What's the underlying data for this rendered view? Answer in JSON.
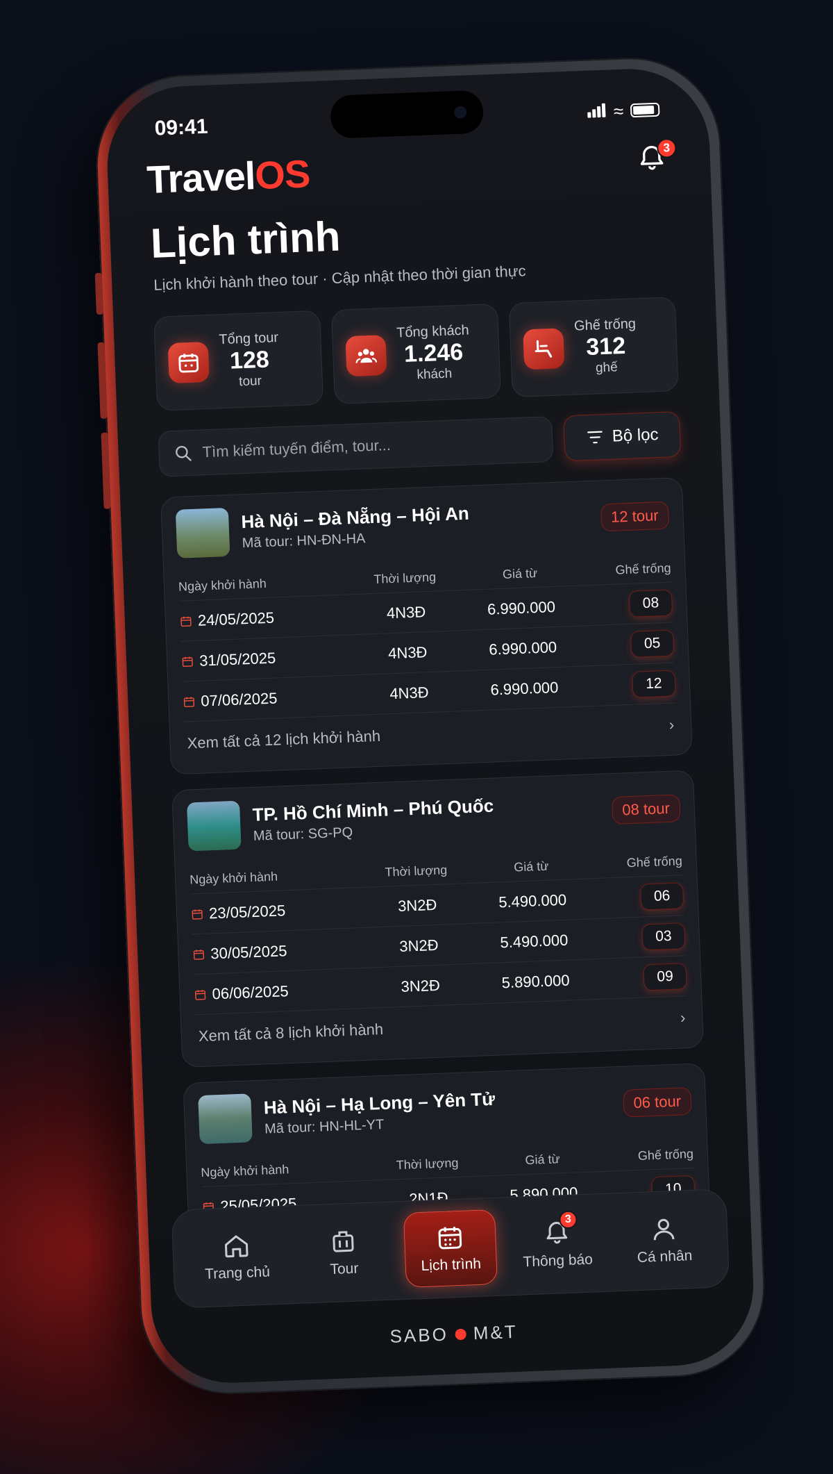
{
  "status": {
    "time": "09:41"
  },
  "app": {
    "logo_a": "Travel",
    "logo_b": "OS",
    "notif_count": "3"
  },
  "page": {
    "title": "Lịch trình",
    "subtitle": "Lịch khởi hành theo tour · Cập nhật theo thời gian thực"
  },
  "stats": [
    {
      "label": "Tổng tour",
      "value": "128",
      "unit": "tour",
      "icon": "calendar-icon"
    },
    {
      "label": "Tổng khách",
      "value": "1.246",
      "unit": "khách",
      "icon": "users-icon"
    },
    {
      "label": "Ghế trống",
      "value": "312",
      "unit": "ghế",
      "icon": "seat-icon"
    }
  ],
  "search": {
    "placeholder": "Tìm kiếm tuyến điểm, tour..."
  },
  "filter": {
    "label": "Bộ lọc"
  },
  "columns": {
    "date": "Ngày khởi hành",
    "duration": "Thời lượng",
    "price": "Giá từ",
    "seats": "Ghế trống"
  },
  "tours": [
    {
      "name": "Hà Nội – Đà Nẵng – Hội An",
      "code": "Mã tour: HN-ĐN-HA",
      "count": "12 tour",
      "rows": [
        {
          "date": "24/05/2025",
          "duration": "4N3Đ",
          "price": "6.990.000",
          "seats": "08"
        },
        {
          "date": "31/05/2025",
          "duration": "4N3Đ",
          "price": "6.990.000",
          "seats": "05"
        },
        {
          "date": "07/06/2025",
          "duration": "4N3Đ",
          "price": "6.990.000",
          "seats": "12"
        }
      ],
      "footer": "Xem tất cả 12 lịch khởi hành"
    },
    {
      "name": "TP. Hồ Chí Minh – Phú Quốc",
      "code": "Mã tour: SG-PQ",
      "count": "08 tour",
      "rows": [
        {
          "date": "23/05/2025",
          "duration": "3N2Đ",
          "price": "5.490.000",
          "seats": "06"
        },
        {
          "date": "30/05/2025",
          "duration": "3N2Đ",
          "price": "5.490.000",
          "seats": "03"
        },
        {
          "date": "06/06/2025",
          "duration": "3N2Đ",
          "price": "5.890.000",
          "seats": "09"
        }
      ],
      "footer": "Xem tất cả 8 lịch khởi hành"
    },
    {
      "name": "Hà Nội – Hạ Long – Yên Tử",
      "code": "Mã tour: HN-HL-YT",
      "count": "06 tour",
      "rows": [
        {
          "date": "25/05/2025",
          "duration": "2N1Đ",
          "price": "5.890.000",
          "seats": "10"
        }
      ],
      "footer": ""
    }
  ],
  "tabs": [
    {
      "label": "Trang chủ",
      "icon": "home-icon"
    },
    {
      "label": "Tour",
      "icon": "suitcase-icon"
    },
    {
      "label": "Lịch trình",
      "icon": "calendar-icon",
      "active": true
    },
    {
      "label": "Thông báo",
      "icon": "bell-icon",
      "badge": "3"
    },
    {
      "label": "Cá nhân",
      "icon": "user-icon"
    }
  ],
  "brand": {
    "left": "SABO",
    "right": "M&T"
  },
  "colors": {
    "accent": "#ff3b30",
    "card": "#1e2127",
    "background": "#0b0f1a"
  }
}
